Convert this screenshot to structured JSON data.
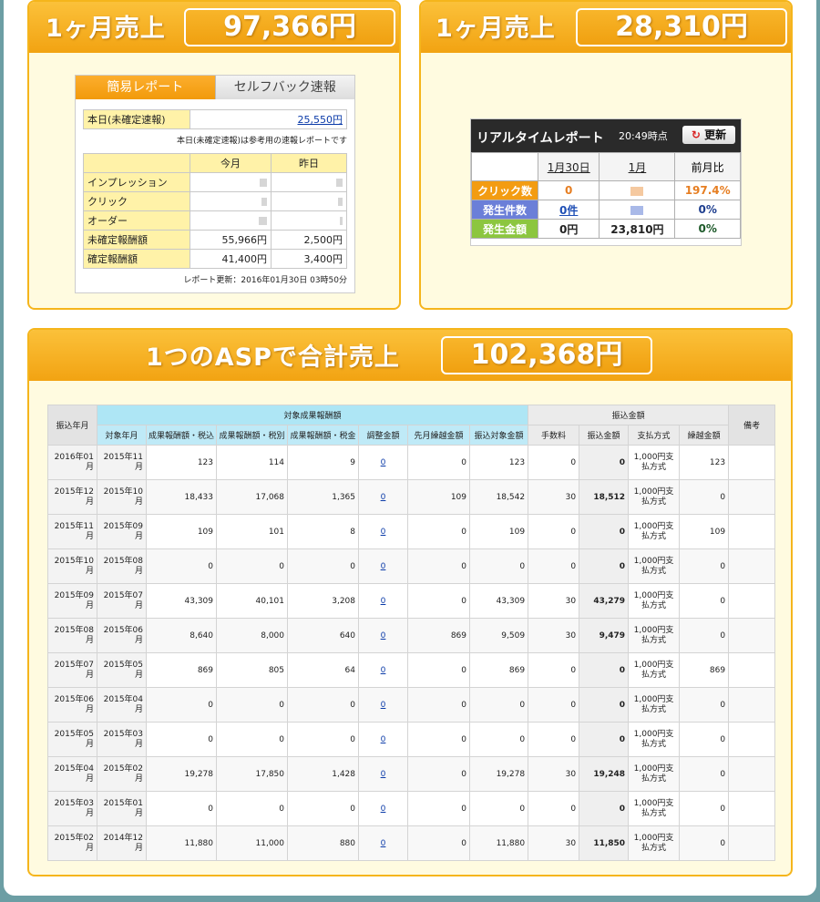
{
  "panel1": {
    "title": "1ヶ月売上",
    "amount": "97,366円"
  },
  "panel2": {
    "title": "1ヶ月売上",
    "amount": "28,310円"
  },
  "panel3": {
    "title": "1つのASPで合計売上",
    "amount": "102,368円"
  },
  "simple_report": {
    "tab_active": "簡易レポート",
    "tab_inactive": "セルフバック速報",
    "today_label": "本日(未確定速報)",
    "today_value": "25,550円",
    "note": "本日(未確定速報)は参考用の速報レポートです",
    "col_this_month": "今月",
    "col_yesterday": "昨日",
    "rows": [
      {
        "label": "インプレッション",
        "this_month": "",
        "yesterday": ""
      },
      {
        "label": "クリック",
        "this_month": "",
        "yesterday": ""
      },
      {
        "label": "オーダー",
        "this_month": "",
        "yesterday": ""
      },
      {
        "label": "未確定報酬額",
        "this_month": "55,966円",
        "yesterday": "2,500円"
      },
      {
        "label": "確定報酬額",
        "this_month": "41,400円",
        "yesterday": "3,400円"
      }
    ],
    "updated": "レポート更新：2016年01月30日 03時50分"
  },
  "realtime": {
    "title": "リアルタイムレポート",
    "time": "20:49時点",
    "refresh_label": "更新",
    "col_day": "1月30日",
    "col_month": "1月",
    "col_ratio": "前月比",
    "rows": [
      {
        "label": "クリック数",
        "day": "0",
        "month": "",
        "ratio": "197.4%",
        "color": "#f39c12"
      },
      {
        "label": "発生件数",
        "day": "0件",
        "month": "",
        "ratio": "0%",
        "color": "#6b7fd8"
      },
      {
        "label": "発生金額",
        "day": "0円",
        "month": "23,810円",
        "ratio": "0%",
        "color": "#8cc63f"
      }
    ]
  },
  "payout": {
    "h_date": "振込年月",
    "h_target_group": "対象成果報酬額",
    "h_payment_group": "振込金額",
    "h_note": "備考",
    "h_cols": [
      "対象年月",
      "成果報酬額・税込",
      "成果報酬額・税別",
      "成果報酬額・税金",
      "調整金額",
      "先月繰越金額",
      "振込対象金額",
      "手数料",
      "振込金額",
      "支払方式",
      "繰越金額"
    ],
    "rows": [
      {
        "pay": "2016年01月",
        "target": "2015年11月",
        "incl": "123",
        "excl": "114",
        "tax": "9",
        "adj": "0",
        "prev": "0",
        "subject": "123",
        "fee": "0",
        "amount": "0",
        "method": "1,000円支払方式",
        "carry": "123"
      },
      {
        "pay": "2015年12月",
        "target": "2015年10月",
        "incl": "18,433",
        "excl": "17,068",
        "tax": "1,365",
        "adj": "0",
        "prev": "109",
        "subject": "18,542",
        "fee": "30",
        "amount": "18,512",
        "method": "1,000円支払方式",
        "carry": "0"
      },
      {
        "pay": "2015年11月",
        "target": "2015年09月",
        "incl": "109",
        "excl": "101",
        "tax": "8",
        "adj": "0",
        "prev": "0",
        "subject": "109",
        "fee": "0",
        "amount": "0",
        "method": "1,000円支払方式",
        "carry": "109"
      },
      {
        "pay": "2015年10月",
        "target": "2015年08月",
        "incl": "0",
        "excl": "0",
        "tax": "0",
        "adj": "0",
        "prev": "0",
        "subject": "0",
        "fee": "0",
        "amount": "0",
        "method": "1,000円支払方式",
        "carry": "0"
      },
      {
        "pay": "2015年09月",
        "target": "2015年07月",
        "incl": "43,309",
        "excl": "40,101",
        "tax": "3,208",
        "adj": "0",
        "prev": "0",
        "subject": "43,309",
        "fee": "30",
        "amount": "43,279",
        "method": "1,000円支払方式",
        "carry": "0"
      },
      {
        "pay": "2015年08月",
        "target": "2015年06月",
        "incl": "8,640",
        "excl": "8,000",
        "tax": "640",
        "adj": "0",
        "prev": "869",
        "subject": "9,509",
        "fee": "30",
        "amount": "9,479",
        "method": "1,000円支払方式",
        "carry": "0"
      },
      {
        "pay": "2015年07月",
        "target": "2015年05月",
        "incl": "869",
        "excl": "805",
        "tax": "64",
        "adj": "0",
        "prev": "0",
        "subject": "869",
        "fee": "0",
        "amount": "0",
        "method": "1,000円支払方式",
        "carry": "869"
      },
      {
        "pay": "2015年06月",
        "target": "2015年04月",
        "incl": "0",
        "excl": "0",
        "tax": "0",
        "adj": "0",
        "prev": "0",
        "subject": "0",
        "fee": "0",
        "amount": "0",
        "method": "1,000円支払方式",
        "carry": "0"
      },
      {
        "pay": "2015年05月",
        "target": "2015年03月",
        "incl": "0",
        "excl": "0",
        "tax": "0",
        "adj": "0",
        "prev": "0",
        "subject": "0",
        "fee": "0",
        "amount": "0",
        "method": "1,000円支払方式",
        "carry": "0"
      },
      {
        "pay": "2015年04月",
        "target": "2015年02月",
        "incl": "19,278",
        "excl": "17,850",
        "tax": "1,428",
        "adj": "0",
        "prev": "0",
        "subject": "19,278",
        "fee": "30",
        "amount": "19,248",
        "method": "1,000円支払方式",
        "carry": "0"
      },
      {
        "pay": "2015年03月",
        "target": "2015年01月",
        "incl": "0",
        "excl": "0",
        "tax": "0",
        "adj": "0",
        "prev": "0",
        "subject": "0",
        "fee": "0",
        "amount": "0",
        "method": "1,000円支払方式",
        "carry": "0"
      },
      {
        "pay": "2015年02月",
        "target": "2014年12月",
        "incl": "11,880",
        "excl": "11,000",
        "tax": "880",
        "adj": "0",
        "prev": "0",
        "subject": "11,880",
        "fee": "30",
        "amount": "11,850",
        "method": "1,000円支払方式",
        "carry": "0"
      }
    ]
  }
}
